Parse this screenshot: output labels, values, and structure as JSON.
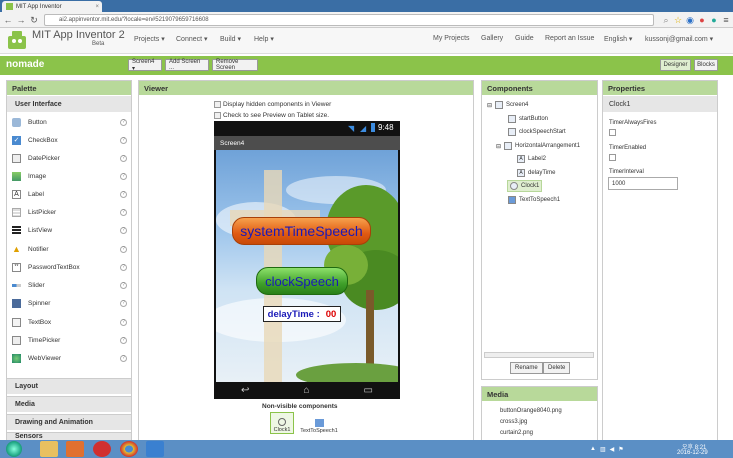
{
  "browser": {
    "tab_title": "MIT App Inventor",
    "url": "ai2.appinventor.mit.edu/?locale=en#5219079659716608"
  },
  "app": {
    "name": "MIT App Inventor 2",
    "beta": "Beta",
    "menus": [
      "Projects ▾",
      "Connect ▾",
      "Build ▾",
      "Help ▾"
    ],
    "right_menus": [
      "My Projects",
      "Gallery",
      "Guide",
      "Report an Issue",
      "English ▾",
      "kussonj@gmail.com ▾"
    ]
  },
  "project": {
    "name": "nomade",
    "screen_select": "Screen4 ▾",
    "add_screen": "Add Screen ...",
    "remove_screen": "Remove Screen",
    "designer": "Designer",
    "blocks": "Blocks"
  },
  "palette": {
    "title": "Palette",
    "category": "User Interface",
    "items": [
      "Button",
      "CheckBox",
      "DatePicker",
      "Image",
      "Label",
      "ListPicker",
      "ListView",
      "Notifier",
      "PasswordTextBox",
      "Slider",
      "Spinner",
      "TextBox",
      "TimePicker",
      "WebViewer"
    ],
    "sections": [
      "Layout",
      "Media",
      "Drawing and Animation",
      "Sensors"
    ]
  },
  "viewer": {
    "title": "Viewer",
    "chk_hidden": "Display hidden components in Viewer",
    "chk_tablet": "Check to see Preview on Tablet size.",
    "status_time": "9:48",
    "screen_title": "Screen4",
    "btn_system": "systemTimeSpeech",
    "btn_clock": "clockSpeech",
    "label_delay": "delayTime :",
    "label_value": "00",
    "nonvisible_title": "Non-visible components",
    "nv_clock": "Clock1",
    "nv_tts": "TextToSpeech1"
  },
  "components": {
    "title": "Components",
    "tree": [
      "Screen4",
      "startButton",
      "clockSpeechStart",
      "HorizontalArrangement1",
      "Label2",
      "delayTime",
      "Clock1",
      "TextToSpeech1"
    ],
    "rename": "Rename",
    "delete": "Delete"
  },
  "media": {
    "title": "Media",
    "files": [
      "buttonOrange8040.png",
      "cross3.jpg",
      "curtain2.png"
    ]
  },
  "properties": {
    "title": "Properties",
    "component": "Clock1",
    "p1": "TimerAlwaysFires",
    "p2": "TimerEnabled",
    "p3": "TimerInterval",
    "interval_value": "1000"
  },
  "taskbar": {
    "time": "오후 8:21",
    "date": "2016-12-29"
  },
  "colors": {
    "accent_green": "#8bc34a",
    "panel_header": "#b8d99a"
  }
}
